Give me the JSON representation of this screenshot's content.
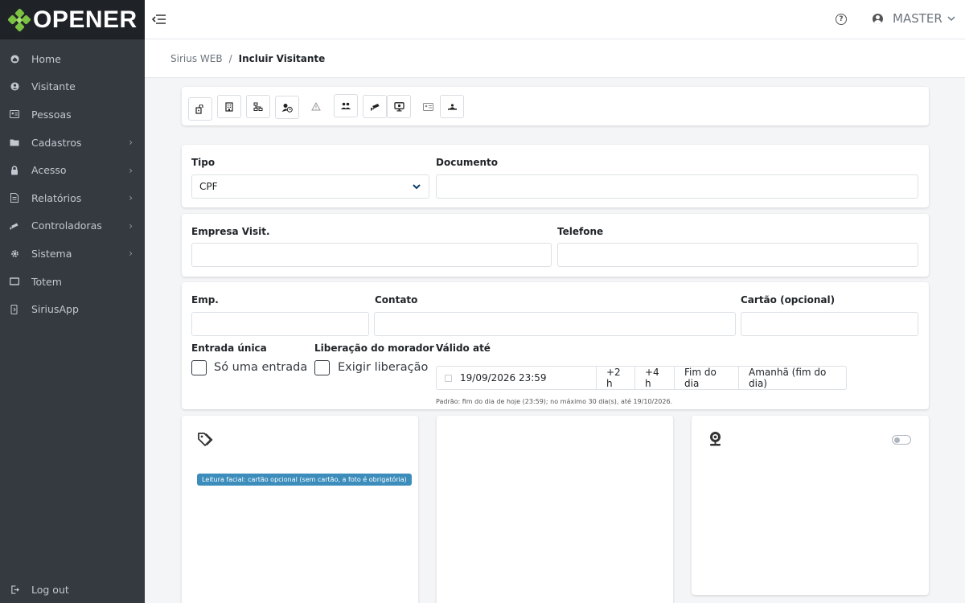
{
  "app": {
    "logo_text": "OPENER"
  },
  "sidebar": {
    "items": [
      {
        "label": "Home",
        "icon": "home-icon",
        "has_submenu": false
      },
      {
        "label": "Visitante",
        "icon": "visitor-icon",
        "has_submenu": false
      },
      {
        "label": "Pessoas",
        "icon": "id-card-icon",
        "has_submenu": false
      },
      {
        "label": "Cadastros",
        "icon": "folder-icon",
        "has_submenu": true
      },
      {
        "label": "Acesso",
        "icon": "lock-icon",
        "has_submenu": true
      },
      {
        "label": "Relatórios",
        "icon": "report-icon",
        "has_submenu": true
      },
      {
        "label": "Controladoras",
        "icon": "camera-icon",
        "has_submenu": true
      },
      {
        "label": "Sistema",
        "icon": "gear-icon",
        "has_submenu": true
      },
      {
        "label": "Totem",
        "icon": "monitor-icon",
        "has_submenu": false
      },
      {
        "label": "SiriusApp",
        "icon": "mobile-icon",
        "has_submenu": false
      }
    ],
    "logout_label": "Log out"
  },
  "header": {
    "user_name": "MASTER"
  },
  "breadcrumb": {
    "parent": "Sirius WEB",
    "separator": "/",
    "current": "Incluir Visitante"
  },
  "form": {
    "tipo_label": "Tipo",
    "tipo_value": "CPF",
    "documento_label": "Documento",
    "documento_value": "",
    "empresa_label": "Empresa Visit.",
    "empresa_value": "",
    "telefone_label": "Telefone",
    "telefone_value": "",
    "emp_label": "Emp.",
    "emp_value": "",
    "contato_label": "Contato",
    "contato_value": "",
    "cartao_label": "Cartão (opcional)",
    "cartao_value": "",
    "entrada_label": "Entrada única",
    "entrada_check": "Só uma entrada",
    "entrada_checked": false,
    "liberacao_label": "Liberação do morador",
    "liberacao_check": "Exigir liberação",
    "liberacao_checked": false,
    "valido_label": "Válido até",
    "valido_value": "19/09/2026 23:59",
    "quick_buttons": [
      "+2 h",
      "+4 h",
      "Fim do dia",
      "Amanhã (fim do dia)"
    ],
    "valido_help": "Padrão: fim do dia de hoje (23:59); no máximo 30 dia(s), até 19/10/2026."
  },
  "panels": {
    "badge_text": "Leitura facial: cartão opcional (sem cartão, a foto é obrigatória)",
    "webcam_enabled": false
  },
  "toolbar": {
    "icons": [
      "door-open-icon",
      "building-icon",
      "hierarchy-icon",
      "user-clock-icon",
      "warning-icon",
      "users-icon",
      "security-camera-icon",
      "kiosk-icon",
      "id-card-icon",
      "reader-icon"
    ]
  },
  "colors": {
    "sidebar_bg": "#343a40",
    "logo_bg": "#1f2327",
    "brand_green": "#7cc142",
    "badge_blue": "#3c8dbc",
    "select_chevron": "#0d3c70"
  }
}
